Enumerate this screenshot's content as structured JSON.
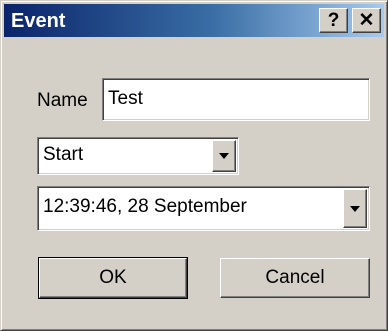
{
  "window": {
    "title": "Event",
    "help_label": "?",
    "close_label": "✕"
  },
  "form": {
    "name_label": "Name",
    "name_value": "Test",
    "type_selected": "Start",
    "datetime_selected": "12:39:46, 28 September"
  },
  "buttons": {
    "ok_label": "OK",
    "cancel_label": "Cancel"
  },
  "colors": {
    "title_gradient_start": "#0a246a",
    "title_gradient_end": "#a6caf0",
    "face": "#d4d0c8"
  }
}
